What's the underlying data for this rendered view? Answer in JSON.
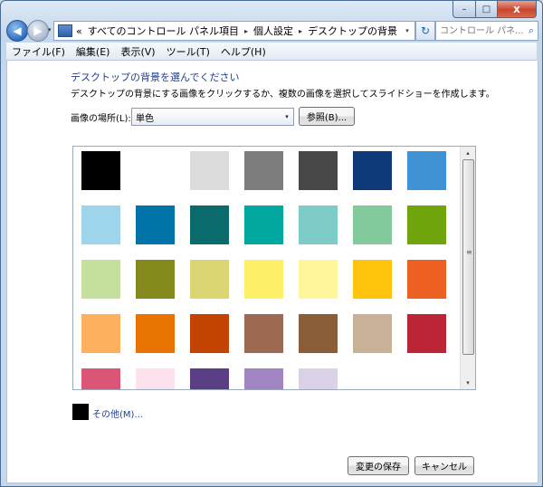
{
  "window": {
    "caption_buttons": {
      "minimize": "–",
      "maximize": "□",
      "close": "x"
    }
  },
  "nav": {
    "back_glyph": "◀",
    "forward_glyph": "▶",
    "address": {
      "prefix": "«",
      "crumbs": [
        "すべてのコントロール パネル項目",
        "個人設定",
        "デスクトップの背景"
      ],
      "separator": "▸",
      "dropdown_glyph": "▾"
    },
    "refresh_glyph": "↻",
    "search_placeholder": "コントロール パネ...",
    "search_glyph": "⌕"
  },
  "menu": [
    "ファイル(F)",
    "編集(E)",
    "表示(V)",
    "ツール(T)",
    "ヘルプ(H)"
  ],
  "content": {
    "heading": "デスクトップの背景を選んでください",
    "description": "デスクトップの背景にする画像をクリックするか、複数の画像を選択してスライドショーを作成します。",
    "location_label": "画像の場所(L):",
    "location_value": "単色",
    "location_arrow": "▾",
    "browse_label": "参照(B)...",
    "other_label": "その他(M)...",
    "other_color": "#000000",
    "save_label": "変更の保存",
    "cancel_label": "キャンセル",
    "scroll_up": "▴",
    "scroll_down": "▾",
    "scroll_grip": "≡"
  },
  "swatches": [
    "#000000",
    "#ffffff",
    "#dcdcdc",
    "#7d7d7d",
    "#474747",
    "#0f3a7a",
    "#3f93d5",
    "#9dd6eb",
    "#0073a8",
    "#0b6a6b",
    "#00a89f",
    "#7dccc7",
    "#82c99b",
    "#6fa40c",
    "#c5df9d",
    "#858a1e",
    "#dbd572",
    "#fff06a",
    "#fff59a",
    "#ffc30b",
    "#ec6121",
    "#fdb05e",
    "#e97300",
    "#c34400",
    "#9c6a52",
    "#8a5e38",
    "#c8b196",
    "#bc2535",
    "#da5576",
    "#fde1ed",
    "#5a3f84",
    "#a185c2",
    "#dcd2e7"
  ]
}
